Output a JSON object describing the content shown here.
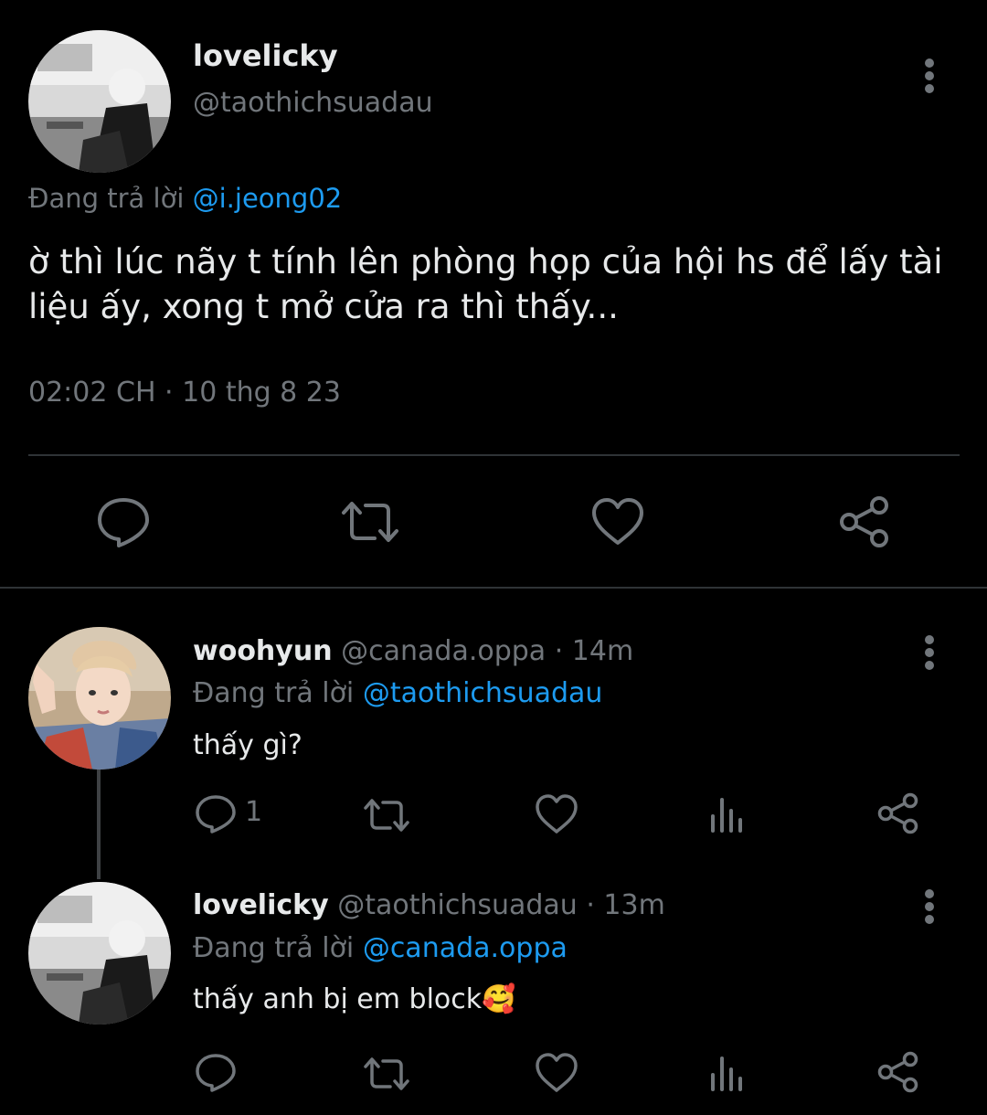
{
  "main_tweet": {
    "name": "lovelicky",
    "handle": "@taothichsuadau",
    "replying_prefix": "Đang trả lời ",
    "replying_to": "@i.jeong02",
    "text": "ờ thì lúc nãy t tính lên phòng họp của hội hs để lấy tài liệu ấy, xong t mở cửa ra thì thấy...",
    "timestamp": "02:02 CH · 10 thg 8 23",
    "actions": [
      "reply-icon",
      "retweet-icon",
      "like-icon",
      "share-icon"
    ]
  },
  "replies": [
    {
      "name": "woohyun",
      "handle": "@canada.oppa",
      "time_sep": " · ",
      "time": "14m",
      "replying_prefix": "Đang trả lời ",
      "replying_to": "@taothichsuadau",
      "text": "thấy gì?",
      "reply_count": "1",
      "actions": [
        "reply-icon",
        "retweet-icon",
        "like-icon",
        "views-icon",
        "share-icon"
      ]
    },
    {
      "name": "lovelicky",
      "handle": "@taothichsuadau",
      "time_sep": " · ",
      "time": "13m",
      "replying_prefix": "Đang trả lời ",
      "replying_to": "@canada.oppa",
      "text": "thấy anh bị em block",
      "emoji": "🥰",
      "actions": [
        "reply-icon",
        "retweet-icon",
        "like-icon",
        "views-icon",
        "share-icon"
      ]
    }
  ],
  "colors": {
    "background": "#000000",
    "text": "#e7e9ea",
    "muted": "#71767b",
    "link": "#1d9bf0",
    "divider": "#2f3336"
  }
}
